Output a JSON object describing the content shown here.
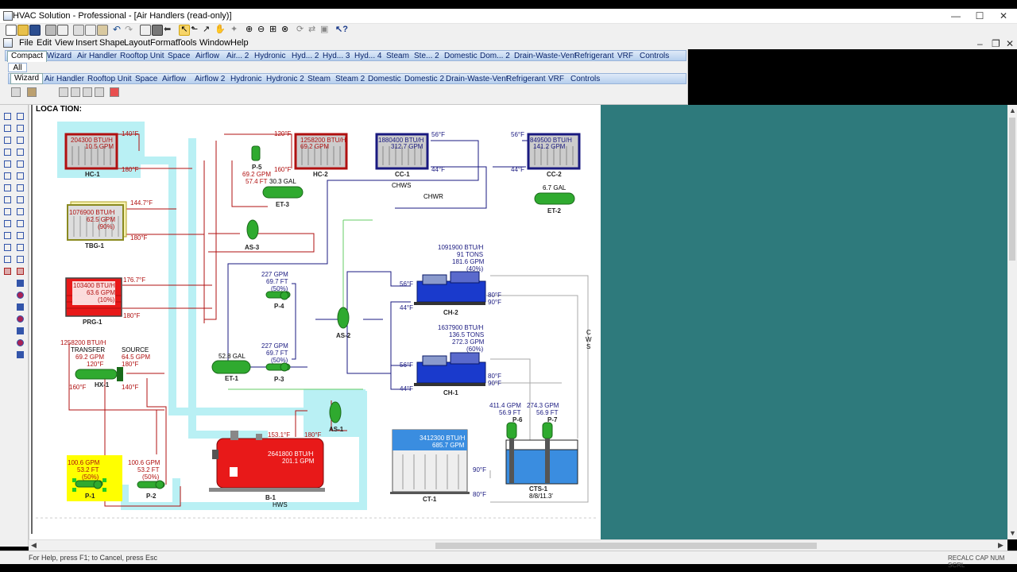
{
  "window": {
    "title": "HVAC Solution - Professional - [Air Handlers (read-only)]",
    "min": "—",
    "max": "☐",
    "close": "✕",
    "mdi_min": "–",
    "mdi_restore": "❐",
    "mdi_close": "✕"
  },
  "menu": [
    "File",
    "Edit",
    "View",
    "Insert",
    "Shape",
    "Layout",
    "Format",
    "Tools",
    "Window",
    "Help"
  ],
  "palette": {
    "row1": [
      "Compact",
      "Wizard",
      "Air Handler",
      "Rooftop Unit",
      "Space",
      "Airflow",
      "Air... 2",
      "Hydronic",
      "Hyd... 2",
      "Hyd... 3",
      "Hyd... 4",
      "Steam",
      "Ste... 2",
      "Domestic",
      "Dom... 2",
      "Drain-Waste-Vent",
      "Refrigerant",
      "VRF",
      "Controls"
    ],
    "all": "All",
    "row2": [
      "Wizard",
      "Air Handler",
      "Rooftop Unit",
      "Space",
      "Airflow",
      "Airflow 2",
      "Hydronic",
      "Hydronic 2",
      "Steam",
      "Steam 2",
      "Domestic",
      "Domestic 2",
      "Drain-Waste-Vent",
      "Refrigerant",
      "VRF",
      "Controls"
    ]
  },
  "diagram": {
    "location": "LOCA  TION:",
    "hc1": {
      "name": "HC-1",
      "btu": "204300 BTU/H",
      "gpm": "10.5 GPM",
      "t_in": "140°F",
      "t_out": "180°F"
    },
    "hc2": {
      "name": "HC-2",
      "btu": "1258200 BTU/H",
      "gpm": "69.2 GPM",
      "t_in": "120°F",
      "t_out": "160°F"
    },
    "cc1": {
      "name": "CC-1",
      "btu": "1880400 BTU/H",
      "gpm": "312.7 GPM",
      "t_in": "56°F",
      "t_out": "44°F"
    },
    "cc2": {
      "name": "CC-2",
      "btu": "849500 BTU/H",
      "gpm": "141.2 GPM",
      "t_in": "56°F",
      "t_out": "44°F"
    },
    "tbg1": {
      "name": "TBG-1",
      "btu": "1076900 BTU/H",
      "gpm": "62.5 GPM",
      "pct": "(90%)",
      "t_in": "144.7°F",
      "t_out": "180°F"
    },
    "prg1": {
      "name": "PRG-1",
      "btu": "103400 BTU/H",
      "gpm": "63.6 GPM",
      "pct": "(10%)",
      "t_in": "176.7°F",
      "t_out": "180°F"
    },
    "hx1": {
      "name": "HX-1",
      "btu": "1258200 BTU/H",
      "transfer": "TRANSFER",
      "gpm": "69.2 GPM",
      "t1": "120°F",
      "t2": "160°F",
      "source": "SOURCE",
      "src_gpm": "64.5 GPM",
      "src_t1": "180°F",
      "src_t2": "140°F"
    },
    "p5": {
      "name": "P-5",
      "gpm": "69.2 GPM",
      "ft": "57.4 FT"
    },
    "et3": {
      "name": "ET-3",
      "gal": "30.3 GAL"
    },
    "as3": {
      "name": "AS-3"
    },
    "chws": "CHWS",
    "chwr": "CHWR",
    "et2": {
      "name": "ET-2",
      "gal": "6.7 GAL"
    },
    "ch2": {
      "name": "CH-2",
      "btu": "1091900 BTU/H",
      "tons": "91 TONS",
      "gpm": "181.6 GPM",
      "pct": "(40%)",
      "t_in": "56°F",
      "t_out": "44°F",
      "c_in": "80°F",
      "c_out": "90°F"
    },
    "ch1": {
      "name": "CH-1",
      "btu": "1637900 BTU/H",
      "tons": "136.5 TONS",
      "gpm": "272.3 GPM",
      "pct": "(60%)",
      "t_in": "56°F",
      "t_out": "44°F",
      "c_in": "80°F",
      "c_out": "90°F"
    },
    "p4": {
      "name": "P-4",
      "gpm": "227 GPM",
      "ft": "69.7 FT",
      "pct": "(50%)"
    },
    "p3": {
      "name": "P-3",
      "gpm": "227 GPM",
      "ft": "69.7 FT",
      "pct": "(50%)"
    },
    "as2": {
      "name": "AS-2"
    },
    "et1": {
      "name": "ET-1",
      "gal": "52.8 GAL"
    },
    "cws": [
      "C",
      "W",
      "S"
    ],
    "as1": {
      "name": "AS-1"
    },
    "b1": {
      "name": "B-1",
      "btu": "2641800 BTU/H",
      "gpm": "201.1 GPM",
      "t1": "153.1°F",
      "t2": "180°F"
    },
    "hws": "HWS",
    "p1": {
      "name": "P-1",
      "gpm": "100.6 GPM",
      "ft": "53.2 FT",
      "pct": "(50%)"
    },
    "p2": {
      "name": "P-2",
      "gpm": "100.6 GPM",
      "ft": "53.2 FT",
      "pct": "(50%)"
    },
    "ct1": {
      "name": "CT-1",
      "btu": "3412300 BTU/H",
      "gpm": "685.7 GPM",
      "t_in": "90°F",
      "t_out": "80°F"
    },
    "p6": {
      "name": "P-6",
      "gpm": "411.4 GPM",
      "ft": "56.9 FT"
    },
    "p7": {
      "name": "P-7",
      "gpm": "274.3 GPM",
      "ft": "56.9 FT"
    },
    "cts1": {
      "name": "CTS-1",
      "size": "8/8/11.3'"
    }
  },
  "status": {
    "message": "For Help, press F1; to Cancel, press Esc",
    "indicators": "RECALC  CAP  NUM  SCRL"
  },
  "colors": {
    "side_pane": "#2e7a7c",
    "hot_water_pipe": "#b01010",
    "chilled_water_pipe": "#1a1a80",
    "highlight": "#b9f0f4",
    "selection": "#ffff00",
    "equipment_green": "#2faa2f",
    "boiler_red": "#e81919"
  }
}
